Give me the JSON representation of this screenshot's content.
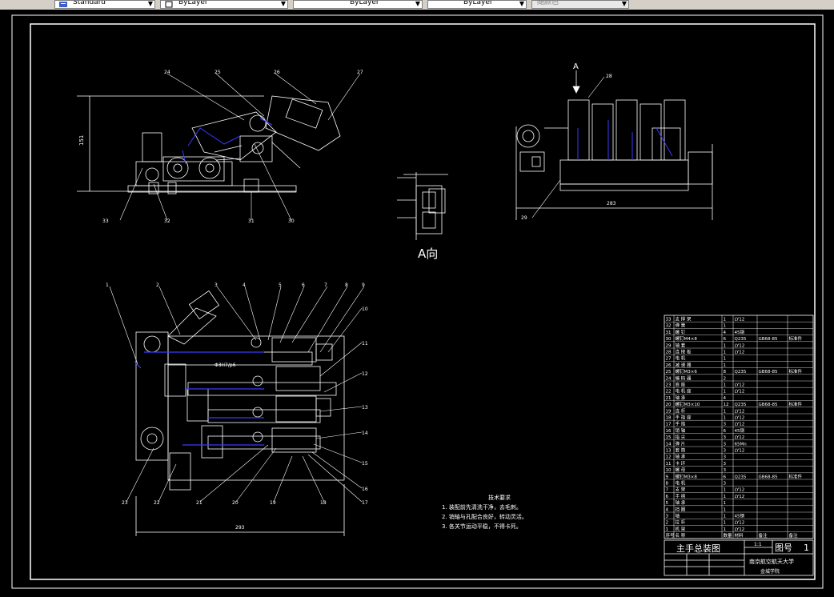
{
  "toolbar": {
    "textstyle": "Standard",
    "layer": "ByLayer",
    "linetype": "ByLayer",
    "lineweight": "ByLayer",
    "plotstyle": "随颜色"
  },
  "drawing": {
    "view_label": "A向",
    "arrow_label": "A",
    "dim_top_height": "151",
    "dim_top_right": "283",
    "dim_bottom": "293",
    "dim_fit_label": "Φ3H7/p6",
    "top_balloons": [
      "24",
      "25",
      "26",
      "27",
      "28",
      "29",
      "30",
      "31",
      "32",
      "33"
    ],
    "bottom_balloons": [
      "1",
      "2",
      "3",
      "4",
      "5",
      "6",
      "7",
      "8",
      "9",
      "10",
      "11",
      "12",
      "13",
      "14",
      "15",
      "16",
      "17",
      "18",
      "19",
      "20",
      "21",
      "22",
      "23"
    ],
    "tech_title": "技术要求",
    "tech_notes": [
      "1.  装配前先清洗干净，去毛刺。",
      "2.  销轴与孔配合良好，转动灵活。",
      "3.  各关节运动平稳，不得卡死。"
    ]
  },
  "title_block": {
    "drawing_title": "主手总装图",
    "drawing_no_label": "图号",
    "drawing_no": "1",
    "school": "南京航空航天大学",
    "dept": "金城学院",
    "scale": "1:1",
    "header_cols": [
      "序号",
      "名  称",
      "数量",
      "材料",
      "备注",
      "备注"
    ],
    "rows": [
      [
        "33",
        "支 撑 架",
        "1",
        "LY12",
        "",
        ""
      ],
      [
        "32",
        "弹   簧",
        "1",
        "",
        "",
        ""
      ],
      [
        "31",
        "螺   钉",
        "4",
        "45钢",
        "",
        ""
      ],
      [
        "30",
        "螺钉M4×8",
        "6",
        "Q235",
        "GB68-85",
        "标准件"
      ],
      [
        "29",
        "轴   套",
        "1",
        "LY12",
        "",
        ""
      ],
      [
        "28",
        "连 接 板",
        "1",
        "LY12",
        "",
        ""
      ],
      [
        "27",
        "电   机",
        "1",
        "",
        "",
        ""
      ],
      [
        "26",
        "减 速 器",
        "1",
        "",
        "",
        ""
      ],
      [
        "25",
        "螺钉M3×6",
        "8",
        "Q235",
        "GB68-85",
        "标准件"
      ],
      [
        "24",
        "编 码 器",
        "2",
        "",
        "",
        ""
      ],
      [
        "23",
        "底   座",
        "1",
        "LY12",
        "",
        ""
      ],
      [
        "22",
        "电 机 座",
        "1",
        "LY12",
        "",
        ""
      ],
      [
        "21",
        "轴   承",
        "4",
        "",
        "",
        ""
      ],
      [
        "20",
        "螺钉M3×10",
        "12",
        "Q235",
        "GB68-85",
        "标准件"
      ],
      [
        "19",
        "连   杆",
        "1",
        "LY12",
        "",
        ""
      ],
      [
        "18",
        "手 指 座",
        "1",
        "LY12",
        "",
        ""
      ],
      [
        "17",
        "手   指",
        "3",
        "LY12",
        "",
        ""
      ],
      [
        "16",
        "销   轴",
        "6",
        "45钢",
        "",
        ""
      ],
      [
        "15",
        "指   尖",
        "3",
        "LY12",
        "",
        ""
      ],
      [
        "14",
        "弹   片",
        "3",
        "65Mn",
        "",
        ""
      ],
      [
        "13",
        "套   筒",
        "3",
        "LY12",
        "",
        ""
      ],
      [
        "12",
        "轴   承",
        "3",
        "",
        "",
        ""
      ],
      [
        "11",
        "卡   环",
        "3",
        "",
        "",
        ""
      ],
      [
        "10",
        "螺   母",
        "3",
        "",
        "",
        ""
      ],
      [
        "9",
        "螺钉M3×8",
        "6",
        "Q235",
        "GB68-85",
        "标准件"
      ],
      [
        "8",
        "电   机",
        "3",
        "",
        "",
        ""
      ],
      [
        "7",
        "支   架",
        "1",
        "LY12",
        "",
        ""
      ],
      [
        "6",
        "手   柄",
        "1",
        "LY12",
        "",
        ""
      ],
      [
        "5",
        "轴   承",
        "1",
        "",
        "",
        ""
      ],
      [
        "4",
        "挡   圈",
        "1",
        "",
        "",
        ""
      ],
      [
        "3",
        "轴",
        "1",
        "45钢",
        "",
        ""
      ],
      [
        "2",
        "拉   杆",
        "1",
        "LY12",
        "",
        ""
      ],
      [
        "1",
        "机   架",
        "1",
        "LY12",
        "",
        ""
      ]
    ]
  },
  "colors": {
    "frame": "#ffffff",
    "dim": "#ffffff",
    "accent": "#3a3aff",
    "bg": "#000000"
  }
}
